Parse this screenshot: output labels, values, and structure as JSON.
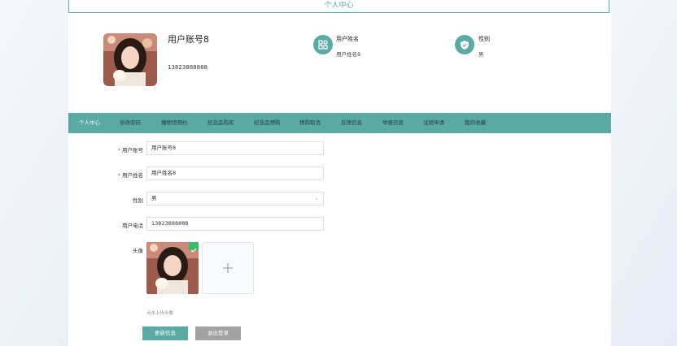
{
  "page": {
    "title": "个人中心"
  },
  "profile": {
    "username": "用户账号8",
    "phone": "13823888888",
    "name_label": "用户姓名",
    "name_value": "用户姓名8",
    "gender_label": "性别",
    "gender_value": "男"
  },
  "nav": {
    "items": [
      "个人中心",
      "修改密码",
      "播物馆预约",
      "纪念品购买",
      "纪念品预购",
      "预购取消",
      "反馈信息",
      "举报信息",
      "注销申请",
      "我的收藏"
    ]
  },
  "form": {
    "account_label": "用户账号",
    "account_value": "用户账号8",
    "name_label": "用户姓名",
    "name_value": "用户姓名8",
    "gender_label": "性别",
    "gender_value": "男",
    "phone_label": "用户电话",
    "phone_value": "13823888888",
    "avatar_label": "头像",
    "avatar_hint": "点击上传头像"
  },
  "buttons": {
    "update": "更新信息",
    "logout": "退出登录"
  },
  "colors": {
    "accent": "#5aa9a2",
    "secondary": "#a2a2a2",
    "required": "#e05050",
    "check": "#3cba6a"
  }
}
